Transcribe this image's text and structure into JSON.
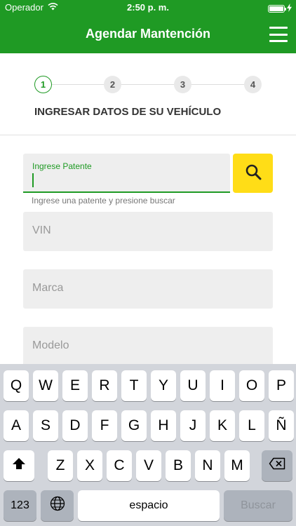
{
  "status_bar": {
    "carrier": "Operador",
    "time": "2:50 p. m.",
    "battery_level": 1.0,
    "icons": [
      "wifi-icon",
      "battery-icon",
      "charging-bolt-icon"
    ]
  },
  "nav": {
    "title": "Agendar Mantención",
    "menu_icon": "hamburger-menu-icon"
  },
  "stepper": {
    "steps": [
      "1",
      "2",
      "3",
      "4"
    ],
    "active_step": 1,
    "title": "INGRESAR DATOS DE SU VEHÍCULO"
  },
  "form": {
    "patente": {
      "label": "Ingrese Patente",
      "value": "",
      "helper": "Ingrese una patente y presione buscar"
    },
    "search_icon": "search-icon",
    "vin": {
      "placeholder": "VIN"
    },
    "marca": {
      "placeholder": "Marca"
    },
    "modelo": {
      "placeholder": "Modelo"
    }
  },
  "keyboard": {
    "row1": [
      "Q",
      "W",
      "E",
      "R",
      "T",
      "Y",
      "U",
      "I",
      "O",
      "P"
    ],
    "row2": [
      "A",
      "S",
      "D",
      "F",
      "G",
      "H",
      "J",
      "K",
      "L",
      "Ñ"
    ],
    "row3": [
      "Z",
      "X",
      "C",
      "V",
      "B",
      "N",
      "M"
    ],
    "numbers_key": "123",
    "space_key": "espacio",
    "search_key": "Buscar",
    "shift_icon": "shift-icon",
    "backspace_icon": "backspace-icon",
    "globe_icon": "globe-icon"
  },
  "colors": {
    "brand_green": "#1f9a24",
    "search_yellow": "#ffdd17"
  }
}
